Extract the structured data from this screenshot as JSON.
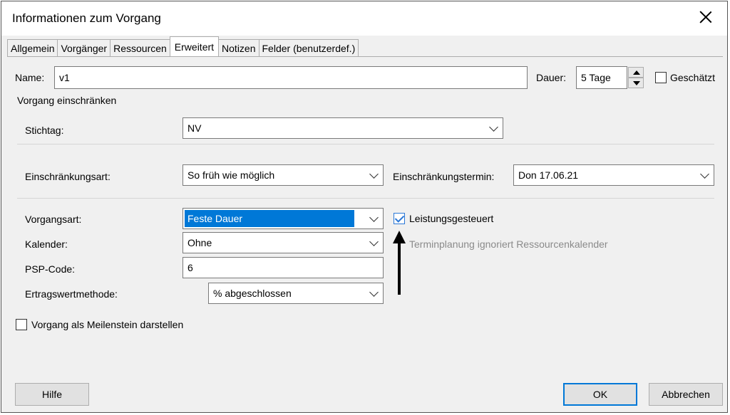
{
  "window": {
    "title": "Informationen zum Vorgang"
  },
  "tabs": [
    {
      "label": "Allgemein"
    },
    {
      "label": "Vorgänger"
    },
    {
      "label": "Ressourcen"
    },
    {
      "label": "Erweitert",
      "active": true
    },
    {
      "label": "Notizen"
    },
    {
      "label": "Felder (benutzerdef.)"
    }
  ],
  "name": {
    "label": "Name:",
    "value": "v1"
  },
  "dauer": {
    "label": "Dauer:",
    "value": "5 Tage"
  },
  "geschaetzt": {
    "label": "Geschätzt",
    "checked": false
  },
  "section_title": "Vorgang einschränken",
  "stichtag": {
    "label": "Stichtag:",
    "value": "NV"
  },
  "einschraenkungsart": {
    "label": "Einschränkungsart:",
    "value": "So früh wie möglich"
  },
  "einschraenkungstermin": {
    "label": "Einschränkungstermin:",
    "value": "Don 17.06.21"
  },
  "vorgangsart": {
    "label": "Vorgangsart:",
    "value": "Feste Dauer"
  },
  "leistungsgesteuert": {
    "label": "Leistungsgesteuert",
    "checked": true
  },
  "kalender": {
    "label": "Kalender:",
    "value": "Ohne"
  },
  "terminplanung": {
    "label": "Terminplanung ignoriert Ressourcenkalender",
    "checked": false
  },
  "psp_code": {
    "label": "PSP-Code:",
    "value": "6"
  },
  "ertragswertmethode": {
    "label": "Ertragswertmethode:",
    "value": "% abgeschlossen"
  },
  "meilenstein": {
    "label": "Vorgang als Meilenstein darstellen",
    "checked": false
  },
  "buttons": {
    "hilfe": "Hilfe",
    "ok": "OK",
    "abbrechen": "Abbrechen"
  },
  "colors": {
    "accent": "#0078d7",
    "dialog_bg": "#f0f0f0"
  },
  "icons": {
    "close": "close-icon",
    "arrow": "up-arrow-annotation"
  }
}
